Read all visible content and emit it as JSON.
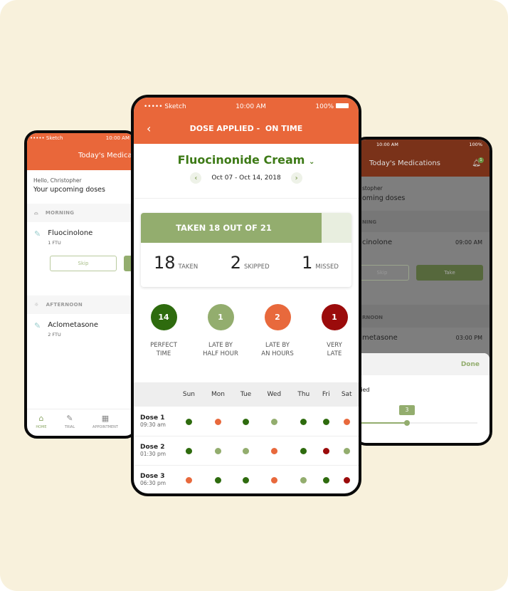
{
  "colors": {
    "accent": "#e9673a",
    "green": "#93ad6e",
    "perfect": "#2e6b0e",
    "half": "#93ad6e",
    "hours": "#e8693c",
    "very": "#9b0b0b"
  },
  "left_phone": {
    "status": {
      "carrier": "••••• Sketch",
      "time": "10:00 AM"
    },
    "title": "Today's Medicat",
    "greeting": "Hello, Christopher",
    "subtitle": "Your upcoming doses",
    "sections": [
      {
        "label": "MORNING",
        "icon": "sunrise-icon",
        "med": "Fluocinolone",
        "qty": "1 FTU",
        "skip": "Skip"
      },
      {
        "label": "AFTERNOON",
        "icon": "sun-icon",
        "med": "Aclometasone",
        "qty": "2 FTU"
      }
    ],
    "tabs": [
      {
        "label": "HOME",
        "icon": "home-icon"
      },
      {
        "label": "TRIAL",
        "icon": "tube-icon"
      },
      {
        "label": "APPOINTMENT",
        "icon": "calendar-icon"
      }
    ]
  },
  "right_phone": {
    "status": {
      "time": "10:00 AM",
      "battery": "100%"
    },
    "title": "Today's Medications",
    "badge": "1",
    "greeting": "stopher",
    "subtitle": "oming doses",
    "morning": "NING",
    "med1": "cinolone",
    "time1": "09:00 AM",
    "skip": "Skip",
    "take": "Take",
    "afternoon": "RNOON",
    "med2": "metasone",
    "time2": "03:00 PM",
    "sheet": {
      "done": "Done",
      "label": "lied",
      "slider_value": "3"
    }
  },
  "center_phone": {
    "status": {
      "carrier": "••••• Sketch",
      "time": "10:00 AM",
      "battery": "100%"
    },
    "title": "DOSE APPLIED -  ON TIME",
    "drug": "Fluocinonide Cream",
    "date_range": "Oct 07 - Oct 14, 2018",
    "summary": {
      "banner": "TAKEN 18 OUT OF 21",
      "taken": 18,
      "total": 21,
      "counts": [
        {
          "n": "18",
          "label": "TAKEN"
        },
        {
          "n": "2",
          "label": "SKIPPED"
        },
        {
          "n": "1",
          "label": "MISSED"
        }
      ]
    },
    "categories": [
      {
        "n": "14",
        "l1": "PERFECT",
        "l2": "TIME",
        "color": "#2e6b0e"
      },
      {
        "n": "1",
        "l1": "LATE BY",
        "l2": "HALF HOUR",
        "color": "#93ad6e"
      },
      {
        "n": "2",
        "l1": "LATE BY",
        "l2": "AN HOURS",
        "color": "#e8693c"
      },
      {
        "n": "1",
        "l1": "VERY",
        "l2": "LATE",
        "color": "#9b0b0b"
      }
    ],
    "days": [
      "Sun",
      "Mon",
      "Tue",
      "Wed",
      "Thu",
      "Fri",
      "Sat"
    ],
    "doses": [
      {
        "name": "Dose 1",
        "time": "09:30 am",
        "status": [
          "perfect",
          "hours",
          "perfect",
          "half",
          "perfect",
          "perfect",
          "hours"
        ]
      },
      {
        "name": "Dose 2",
        "time": "01:30 pm",
        "status": [
          "perfect",
          "half",
          "half",
          "hours",
          "perfect",
          "very",
          "half"
        ]
      },
      {
        "name": "Dose 3",
        "time": "06:30 pm",
        "status": [
          "hours",
          "perfect",
          "perfect",
          "hours",
          "half",
          "perfect",
          "very"
        ]
      }
    ]
  }
}
